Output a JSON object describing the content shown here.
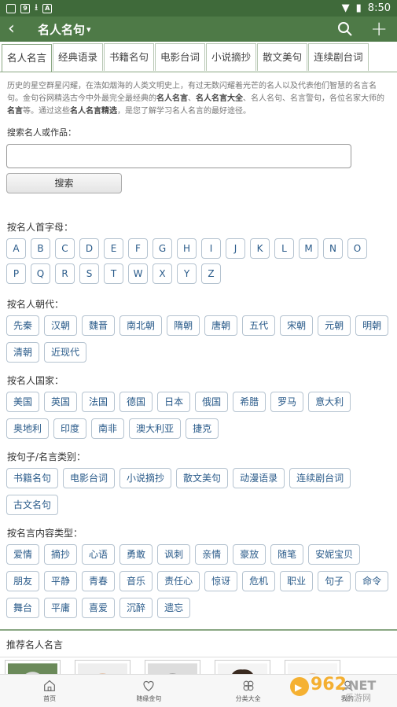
{
  "status": {
    "time": "8:50"
  },
  "appbar": {
    "title": "名人名句",
    "caret": "▾"
  },
  "tabs": [
    "名人名言",
    "经典语录",
    "书籍名句",
    "电影台词",
    "小说摘抄",
    "散文美句",
    "连续剧台词"
  ],
  "intro": {
    "p1": "历史的星空群星闪耀，在浩如烟海的人类文明史上，有过无数闪耀着光芒的名人以及代表他们智慧的名言名句。金句谷网精选古今中外最完全最经典的",
    "b1": "名人名言",
    "p2": "、",
    "b2": "名人名言大全",
    "p3": "、名人名句、名言警句，各位名家大师的",
    "b3": "名言",
    "p4": "等。通过这些",
    "b4": "名人名言精选",
    "p5": "，是您了解学习名人名言的最好途径。"
  },
  "search": {
    "label": "搜索名人或作品：",
    "placeholder": "",
    "button": "搜索"
  },
  "letters": {
    "label": "按名人首字母：",
    "row1": [
      "A",
      "B",
      "C",
      "D",
      "E",
      "F",
      "G",
      "H",
      "I",
      "J",
      "K",
      "L",
      "M",
      "N",
      "O"
    ],
    "row2": [
      "P",
      "Q",
      "R",
      "S",
      "T",
      "W",
      "X",
      "Y",
      "Z"
    ]
  },
  "dynasty": {
    "label": "按名人朝代：",
    "items": [
      "先秦",
      "汉朝",
      "魏晋",
      "南北朝",
      "隋朝",
      "唐朝",
      "五代",
      "宋朝",
      "元朝",
      "明朝",
      "清朝",
      "近现代"
    ]
  },
  "country": {
    "label": "按名人国家：",
    "items": [
      "美国",
      "英国",
      "法国",
      "德国",
      "日本",
      "俄国",
      "希腊",
      "罗马",
      "意大利",
      "奥地利",
      "印度",
      "南非",
      "澳大利亚",
      "捷克"
    ]
  },
  "category": {
    "label": "按句子/名言类别：",
    "items": [
      "书籍名句",
      "电影台词",
      "小说摘抄",
      "散文美句",
      "动漫语录",
      "连续剧台词",
      "古文名句"
    ]
  },
  "content_type": {
    "label": "按名言内容类型：",
    "items": [
      "爱情",
      "摘抄",
      "心语",
      "勇敢",
      "讽刺",
      "亲情",
      "豪放",
      "随笔",
      "安妮宝贝",
      "朋友",
      "平静",
      "青春",
      "音乐",
      "责任心",
      "惊讶",
      "危机",
      "职业",
      "句子",
      "命令",
      "舞台",
      "平庸",
      "喜爱",
      "沉醉",
      "遗忘"
    ]
  },
  "recommend": {
    "label": "推荐名人名言"
  },
  "bottom_nav": [
    "首页",
    "随缘金句",
    "分类大全",
    "我的"
  ],
  "watermark": {
    "main": "962",
    "sub": ".NET",
    "cn": "乐游网"
  },
  "colors": {
    "appbar": "#4e7a47",
    "statusbar": "#3f6a3a",
    "chip_text": "#2a5b8a"
  }
}
